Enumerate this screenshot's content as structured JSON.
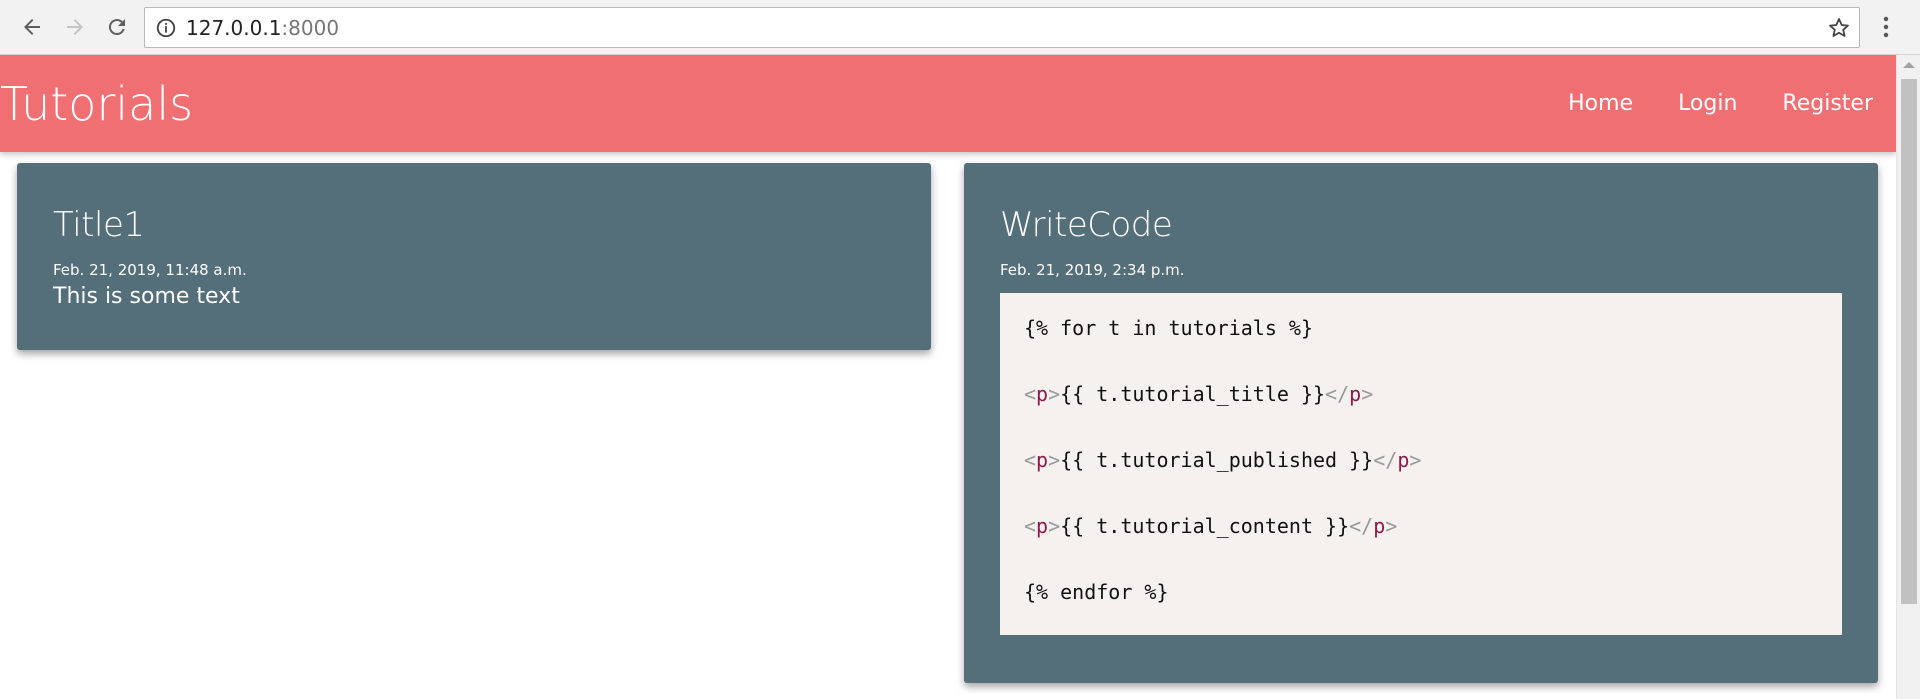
{
  "browser": {
    "url_host": "127.0.0.1",
    "url_port": ":8000",
    "icons": [
      "back-arrow-icon",
      "forward-arrow-icon",
      "reload-icon",
      "info-icon",
      "star-icon",
      "menu-icon"
    ]
  },
  "navbar": {
    "brand": "Tutorials",
    "links": [
      "Home",
      "Login",
      "Register"
    ],
    "color": "#ef6f73"
  },
  "cards": [
    {
      "title": "Title1",
      "date": "Feb. 21, 2019, 11:48 a.m.",
      "text": "This is some text"
    },
    {
      "title": "WriteCode",
      "date": "Feb. 21, 2019, 2:34 p.m.",
      "code": {
        "line1": "{% for t in tutorials %}",
        "line2": "{{ t.tutorial_title }}",
        "line3": "{{ t.tutorial_published }}",
        "line4": "{{ t.tutorial_content }}",
        "line5": "{% endfor %}",
        "tag_open": "<",
        "tag_close": ">",
        "tag_end_open": "</",
        "tag_name": "p"
      }
    }
  ],
  "colors": {
    "card": "#546e7a",
    "code_bg": "#f4f1ee"
  }
}
